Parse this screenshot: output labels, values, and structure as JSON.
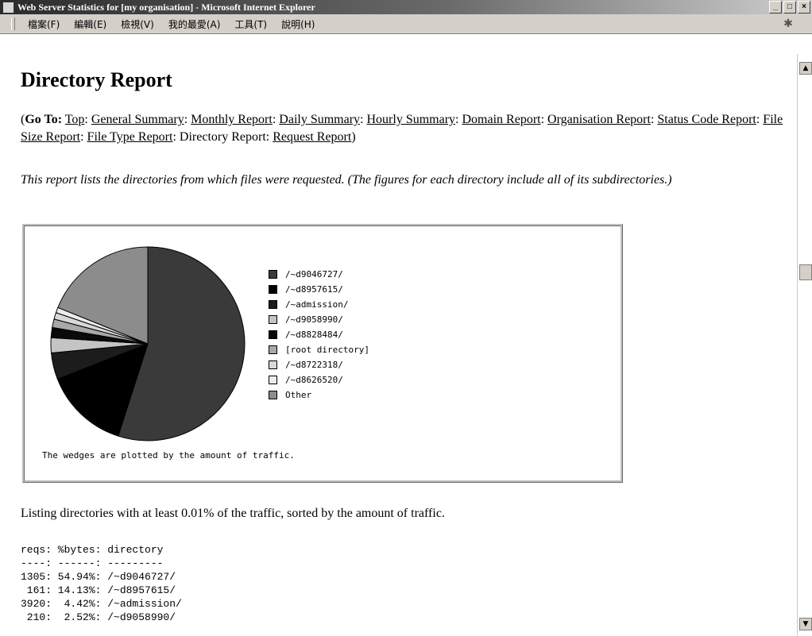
{
  "window": {
    "title": "Web Server Statistics for [my organisation] - Microsoft Internet Explorer",
    "buttons": {
      "minimize": "_",
      "maximize": "□",
      "close": "×"
    }
  },
  "menu": [
    "檔案(F)",
    "編輯(E)",
    "檢視(V)",
    "我的最愛(A)",
    "工具(T)",
    "說明(H)"
  ],
  "page": {
    "heading": "Directory Report",
    "goto_label": "Go To",
    "goto_links": [
      "Top",
      "General Summary",
      "Monthly Report",
      "Daily Summary",
      "Hourly Summary",
      "Domain Report",
      "Organisation Report",
      "Status Code Report",
      "File Size Report",
      "File Type Report"
    ],
    "goto_current": "Directory Report",
    "goto_last_link": "Request Report",
    "description": "This report lists the directories from which files were requested. (The figures for each directory include all of its subdirectories.)",
    "chart_caption": "The wedges are plotted by the amount of traffic.",
    "listing_description": "Listing directories with at least 0.01% of the traffic, sorted by the amount of traffic.",
    "table_header": "reqs: %bytes: directory",
    "table_separator": "----: ------: ---------",
    "table_rows": [
      "1305: 54.94%: /~d9046727/",
      " 161: 14.13%: /~d8957615/",
      "3920:  4.42%: /~admission/",
      " 210:  2.52%: /~d9058990/"
    ]
  },
  "chart_data": {
    "type": "pie",
    "title": "",
    "slices": [
      {
        "label": "/~d9046727/",
        "value": 54.94,
        "color": "#3a3a3a"
      },
      {
        "label": "/~d8957615/",
        "value": 14.13,
        "color": "#000000"
      },
      {
        "label": "/~admission/",
        "value": 4.42,
        "color": "#1c1c1c"
      },
      {
        "label": "/~d9058990/",
        "value": 2.52,
        "color": "#c4c4c4"
      },
      {
        "label": "/~d8828484/",
        "value": 1.7,
        "color": "#0a0a0a"
      },
      {
        "label": "[root directory]",
        "value": 1.4,
        "color": "#a8a8a8"
      },
      {
        "label": "/~d8722318/",
        "value": 1.1,
        "color": "#d8d8d8"
      },
      {
        "label": "/~d8626520/",
        "value": 0.9,
        "color": "#ececec"
      },
      {
        "label": "Other",
        "value": 18.89,
        "color": "#8c8c8c"
      }
    ]
  }
}
